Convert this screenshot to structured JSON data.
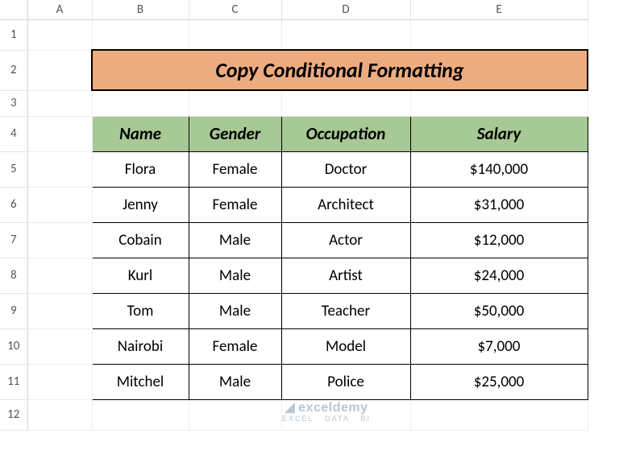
{
  "columns": [
    "A",
    "B",
    "C",
    "D",
    "E"
  ],
  "rows": [
    "1",
    "2",
    "3",
    "4",
    "5",
    "6",
    "7",
    "8",
    "9",
    "10",
    "11",
    "12"
  ],
  "title": "Copy Conditional Formatting",
  "headers": {
    "name": "Name",
    "gender": "Gender",
    "occupation": "Occupation",
    "salary": "Salary"
  },
  "data": [
    {
      "name": "Flora",
      "gender": "Female",
      "occupation": "Doctor",
      "salary": "$140,000"
    },
    {
      "name": "Jenny",
      "gender": "Female",
      "occupation": "Architect",
      "salary": "$31,000"
    },
    {
      "name": "Cobain",
      "gender": "Male",
      "occupation": "Actor",
      "salary": "$12,000"
    },
    {
      "name": "Kurl",
      "gender": "Male",
      "occupation": "Artist",
      "salary": "$24,000"
    },
    {
      "name": "Tom",
      "gender": "Male",
      "occupation": "Teacher",
      "salary": "$50,000"
    },
    {
      "name": "Nairobi",
      "gender": "Female",
      "occupation": "Model",
      "salary": "$7,000"
    },
    {
      "name": "Mitchel",
      "gender": "Male",
      "occupation": "Police",
      "salary": "$25,000"
    }
  ],
  "watermark": {
    "brand": "exceldemy",
    "tagline": "EXCEL · DATA · BI"
  },
  "chart_data": {
    "type": "table",
    "title": "Copy Conditional Formatting",
    "columns": [
      "Name",
      "Gender",
      "Occupation",
      "Salary"
    ],
    "rows": [
      [
        "Flora",
        "Female",
        "Doctor",
        140000
      ],
      [
        "Jenny",
        "Female",
        "Architect",
        31000
      ],
      [
        "Cobain",
        "Male",
        "Actor",
        12000
      ],
      [
        "Kurl",
        "Male",
        "Artist",
        24000
      ],
      [
        "Tom",
        "Male",
        "Teacher",
        50000
      ],
      [
        "Nairobi",
        "Female",
        "Model",
        7000
      ],
      [
        "Mitchel",
        "Male",
        "Police",
        25000
      ]
    ]
  }
}
